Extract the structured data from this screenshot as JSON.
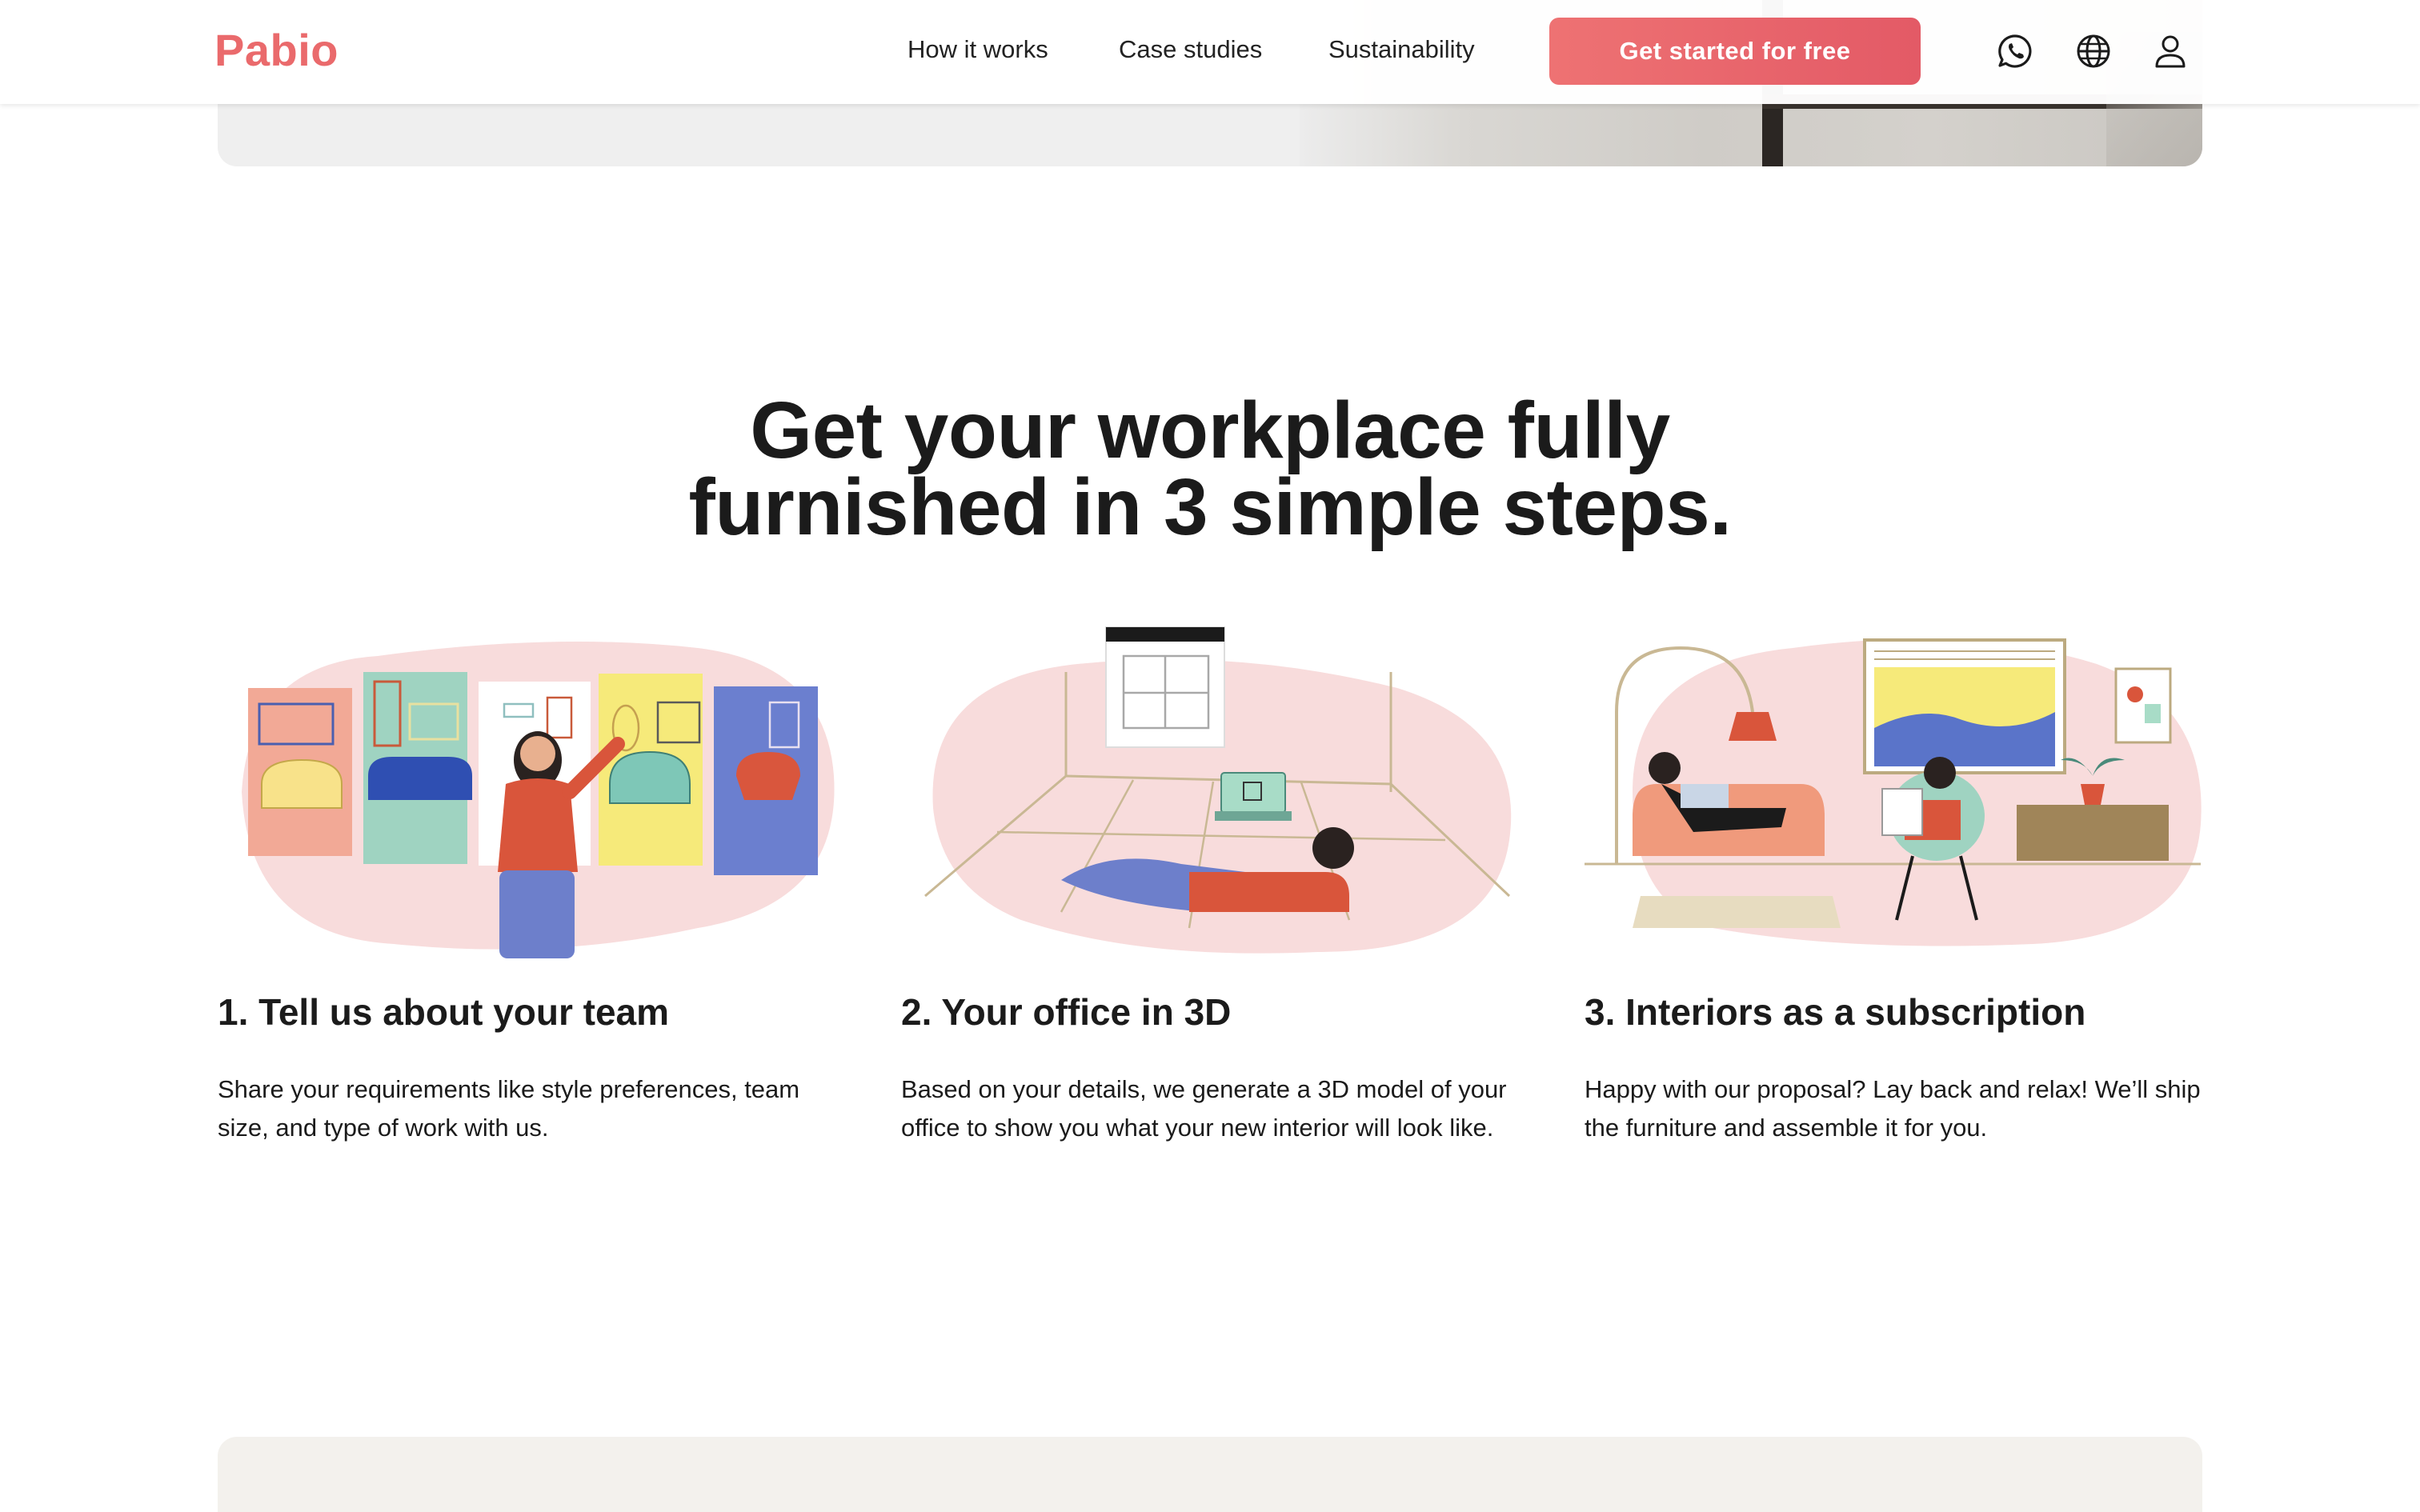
{
  "header": {
    "logo": "Pabio",
    "nav": [
      "How it works",
      "Case studies",
      "Sustainability"
    ],
    "cta_label": "Get started for free",
    "icons": [
      "whatsapp-icon",
      "globe-icon",
      "user-icon"
    ]
  },
  "section": {
    "headline_line1": "Get your workplace fully",
    "headline_line2": "furnished in 3 simple steps.",
    "steps": [
      {
        "title": "1. Tell us about your team",
        "description": "Share your requirements like style preferences, team size, and type of work with us."
      },
      {
        "title": "2. Your office in 3D",
        "description": "Based on your details, we generate a 3D model of your office to show you what your new interior will look like."
      },
      {
        "title": "3. Interiors as a subscription",
        "description": "Happy with our proposal? Lay back and relax! We’ll ship the furniture and assemble it for you."
      }
    ]
  },
  "colors": {
    "brand": "#ea6a6c",
    "cta_gradient_start": "#ee7273",
    "cta_gradient_end": "#e35a66",
    "illustration_blush": "#f8dcdc",
    "bottom_card": "#f3f1ed"
  }
}
